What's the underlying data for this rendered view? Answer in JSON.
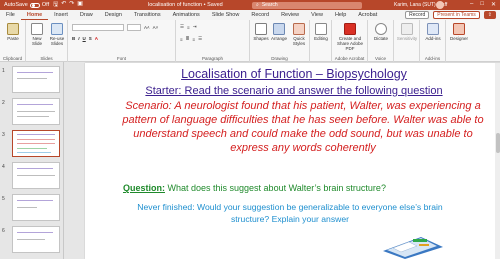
{
  "titlebar": {
    "autosave_label": "AutoSave",
    "autosave_state": "Off",
    "doc_title": "localisation of function • Saved",
    "search_placeholder": "Search",
    "user_name": "Karim, Lana (SUT) Staff",
    "accent_color": "#b7472a"
  },
  "tabs": {
    "items": [
      "File",
      "Home",
      "Insert",
      "Draw",
      "Design",
      "Transitions",
      "Animations",
      "Slide Show",
      "Record",
      "Review",
      "View",
      "Help",
      "Acrobat"
    ],
    "active": "Home",
    "record_label": "Record",
    "present_label": "Present in Teams"
  },
  "ribbon": {
    "clipboard": {
      "paste": "Paste",
      "label": "Clipboard"
    },
    "slides": {
      "new_slide": "New Slide",
      "reuse": "Re-use Slides",
      "label": "Slides"
    },
    "font": {
      "label": "Font"
    },
    "paragraph": {
      "label": "Paragraph"
    },
    "drawing": {
      "shapes": "Shapes",
      "arrange": "Arrange",
      "quick_styles": "Quick Styles",
      "label": "Drawing"
    },
    "editing": {
      "editing": "Editing"
    },
    "acrobat": {
      "create": "Create and Share Adobe PDF",
      "label": "Adobe Acrobat"
    },
    "voice": {
      "dictate": "Dictate",
      "label": "Voice"
    },
    "sensitivity": {
      "sensitivity": "Sensitivity"
    },
    "addins": {
      "addins": "Add-ins",
      "label": "Add-ins"
    },
    "designer": {
      "designer": "Designer"
    }
  },
  "thumbnails": {
    "numbers": [
      "1",
      "2",
      "3",
      "4",
      "5",
      "6"
    ],
    "active_index": 3
  },
  "slide": {
    "title": "Localisation of Function – Biopsychology",
    "starter": "Starter: Read the scenario and answer the following question",
    "scenario": "Scenario: A neurologist found that his patient, Walter, was experiencing a pattern of language difficulties that he has seen before. Walter was able to understand speech and could make the odd sound, but was unable to express any words coherently",
    "question_label": "Question:",
    "question_text": " What does this suggest about Walter’s brain structure?",
    "never_finished": "Never finished: Would your suggestion be generalizable to everyone else’s brain structure? Explain your answer"
  }
}
